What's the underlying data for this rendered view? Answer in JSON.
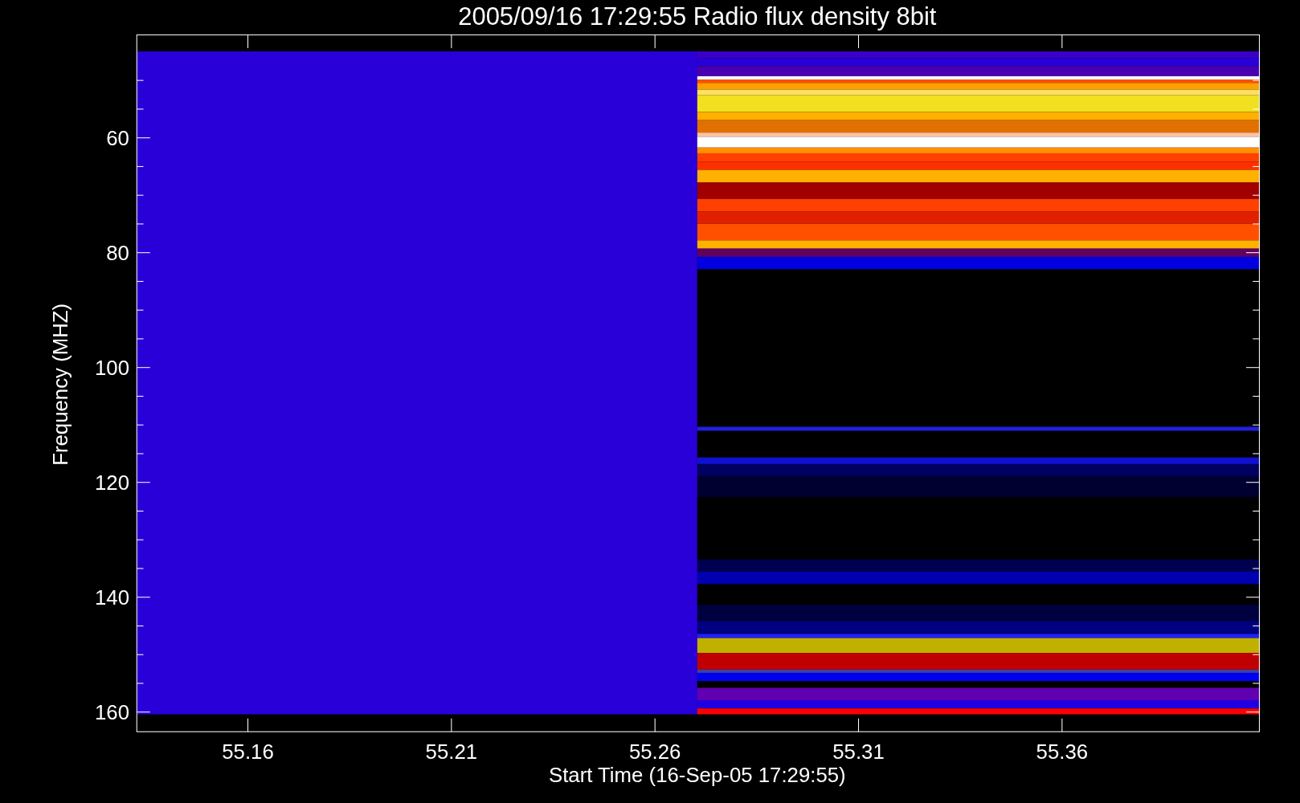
{
  "plot": {
    "title": "2005/09/16 17:29:55 Radio flux density 8bit",
    "xlabel": "Start Time (16-Sep-05 17:29:55)",
    "ylabel": "Frequency (MHZ)",
    "xticks": [
      "55.16",
      "55.21",
      "55.26",
      "55.31",
      "55.36"
    ],
    "yticks": [
      "60",
      "80",
      "100",
      "120",
      "140",
      "160"
    ]
  }
}
